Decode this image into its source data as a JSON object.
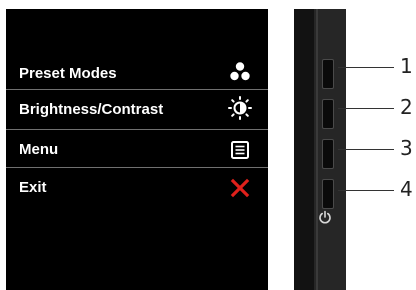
{
  "osd": {
    "items": [
      {
        "label": "Preset Modes",
        "icon": "preset-modes-icon"
      },
      {
        "label": "Brightness/Contrast",
        "icon": "brightness-contrast-icon"
      },
      {
        "label": "Menu",
        "icon": "menu-icon"
      },
      {
        "label": "Exit",
        "icon": "close-icon"
      }
    ]
  },
  "bezel": {
    "buttons": [
      {
        "number": "1"
      },
      {
        "number": "2"
      },
      {
        "number": "3"
      },
      {
        "number": "4"
      }
    ],
    "power_icon": "power-icon"
  },
  "colors": {
    "screen_background": "#000000",
    "label_text": "#ffffff",
    "exit_icon": "#e0201b",
    "callout_text": "#222222"
  }
}
